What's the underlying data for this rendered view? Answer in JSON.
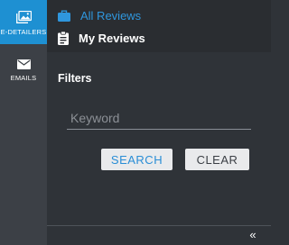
{
  "rail": {
    "items": [
      {
        "label": "E-DETAILERS",
        "icon": "images-icon",
        "active": true
      },
      {
        "label": "EMAILS",
        "icon": "mail-icon",
        "active": false
      }
    ]
  },
  "nav": {
    "items": [
      {
        "label": "All Reviews",
        "icon": "briefcase-icon",
        "active": true
      },
      {
        "label": "My Reviews",
        "icon": "clipboard-icon",
        "active": false
      }
    ]
  },
  "filters": {
    "title": "Filters",
    "keyword_placeholder": "Keyword",
    "keyword_value": "",
    "search_label": "SEARCH",
    "clear_label": "CLEAR"
  },
  "footer": {
    "collapse_glyph": "«"
  },
  "colors": {
    "accent": "#1e90d2",
    "link": "#2f96dd",
    "rail_bg": "#3c4046",
    "panel_bg": "#2f3338",
    "nav_bg": "#2a2d31"
  }
}
